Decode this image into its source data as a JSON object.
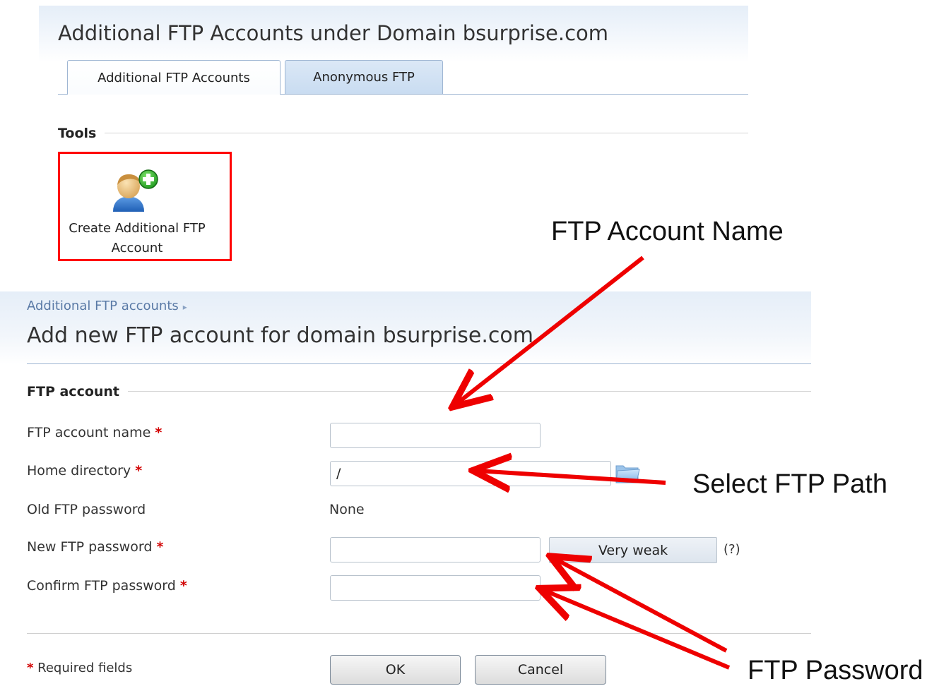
{
  "top_panel": {
    "title": "Additional FTP Accounts under Domain bsurprise.com",
    "tabs": [
      {
        "label": "Additional FTP Accounts",
        "active": true
      },
      {
        "label": "Anonymous FTP",
        "active": false
      }
    ],
    "tools_heading": "Tools",
    "create_tool": {
      "label_line1": "Create Additional FTP",
      "label_line2": "Account",
      "icon": "add-user-icon"
    }
  },
  "form": {
    "breadcrumb": "Additional FTP accounts",
    "title": "Add new FTP account for domain bsurprise.com",
    "section_heading": "FTP account",
    "required_mark": "*",
    "fields": {
      "account_name": {
        "label": "FTP account name",
        "value": ""
      },
      "home_directory": {
        "label": "Home directory",
        "value": "/",
        "icon": "folder-icon"
      },
      "old_password": {
        "label": "Old FTP password",
        "value": "None"
      },
      "new_password": {
        "label": "New FTP password",
        "value": "",
        "strength": "Very weak",
        "help": "(?)"
      },
      "confirm_password": {
        "label": "Confirm FTP password",
        "value": ""
      }
    },
    "required_note": "Required fields",
    "ok_label": "OK",
    "cancel_label": "Cancel"
  },
  "annotations": {
    "account_name": "FTP Account Name",
    "ftp_path": "Select FTP Path",
    "ftp_password": "FTP Password"
  },
  "colors": {
    "highlight": "#ff0000",
    "arrow": "#ee0000",
    "link": "#5a7aa6",
    "required": "#d20000"
  }
}
